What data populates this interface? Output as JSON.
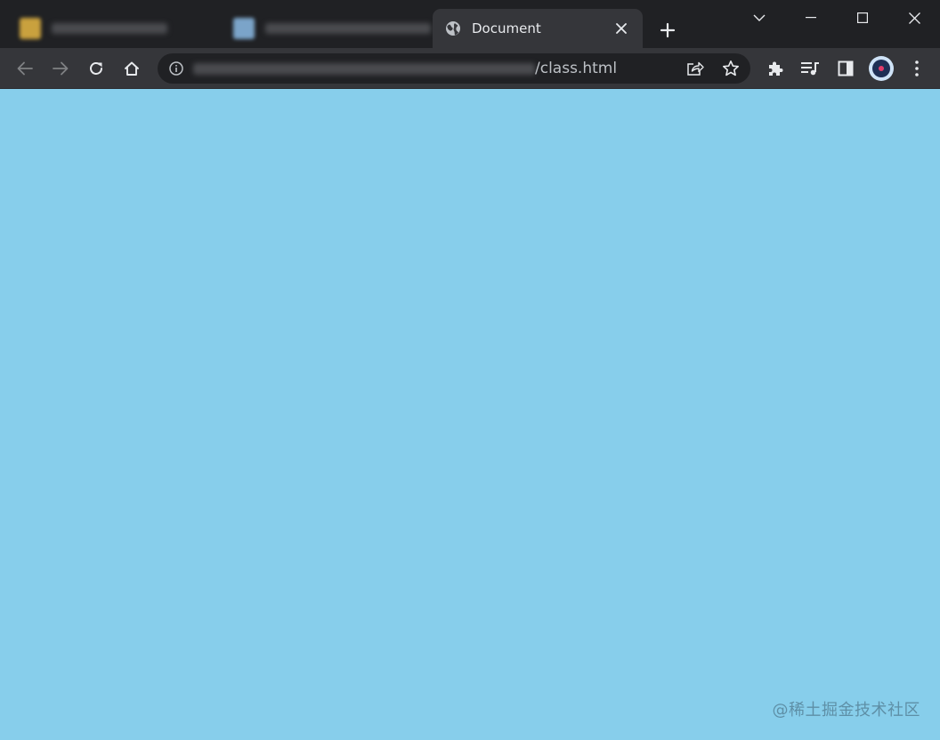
{
  "tabs": [
    {
      "title": "",
      "favicon_color": "#c9a13e",
      "blurred": true
    },
    {
      "title": "",
      "favicon_color": "#7ba4c9",
      "blurred": true
    },
    {
      "title": "Document",
      "favicon": "globe-icon",
      "active": true
    }
  ],
  "new_tab_icon": "plus-icon",
  "window_controls": [
    "tab-search-icon",
    "minimize-icon",
    "maximize-icon",
    "close-icon"
  ],
  "toolbar": {
    "nav_icons": [
      "back-arrow-icon",
      "forward-arrow-icon",
      "reload-icon",
      "home-icon"
    ],
    "extensions_icon": "puzzle-icon",
    "media_icon": "media-queue-icon",
    "side_panel_icon": "side-panel-icon",
    "menu_icon": "kebab-menu-icon"
  },
  "address_bar": {
    "url_visible": "/class.html",
    "info_icon": "info-icon",
    "share_icon": "share-icon",
    "bookmark_icon": "star-icon"
  },
  "page": {
    "background_color": "#87ceeb"
  },
  "watermark": "@稀土掘金技术社区",
  "colors": {
    "frame": "#202124",
    "toolbar": "#35363a",
    "text": "#e8eaed",
    "page_bg": "#87ceeb"
  }
}
